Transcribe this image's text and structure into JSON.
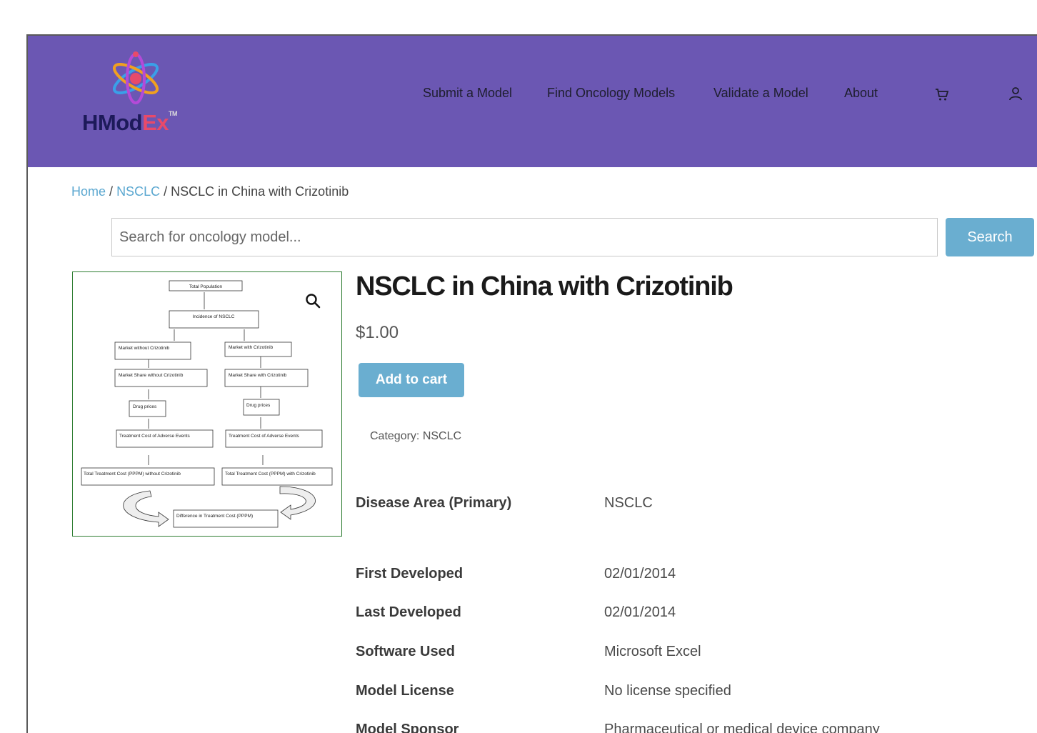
{
  "brand": {
    "name_part1": "HMod",
    "name_part2": "Ex",
    "trademark": "TM"
  },
  "nav": {
    "items": [
      {
        "label": "Submit a Model"
      },
      {
        "label": "Find Oncology Models"
      },
      {
        "label": "Validate a Model"
      },
      {
        "label": "About"
      }
    ],
    "cart_icon": "cart-icon",
    "account_icon": "user-icon"
  },
  "breadcrumb": {
    "home": "Home",
    "separator": "/",
    "category": "NSCLC",
    "current": "NSCLC in China with Crizotinib"
  },
  "search": {
    "placeholder": "Search for oncology model...",
    "value": "",
    "button_label": "Search"
  },
  "product": {
    "title": "NSCLC in China with Crizotinib",
    "price": "$1.00",
    "add_to_cart_label": "Add to cart",
    "category_label": "Category:",
    "category_value": "NSCLC",
    "image": {
      "top": "Total Population",
      "incidence": "Incidence of NSCLC",
      "left_market": "Market without Crizotinib",
      "right_market": "Market with Crizotinib",
      "left_share": "Market Share without Crizotinib",
      "right_share": "Market Share with Crizotinib",
      "drug_prices": "Drug prices",
      "adverse": "Treatment Cost of Adverse Events",
      "left_total": "Total Treatment Cost (PPPM) without Crizotinib",
      "right_total": "Total Treatment Cost (PPPM) with Crizotinib",
      "difference": "Difference in Treatment Cost (PPPM)"
    }
  },
  "specs": [
    {
      "label": "Disease Area (Primary)",
      "value": "NSCLC"
    },
    {
      "label": "First Developed",
      "value": "02/01/2014"
    },
    {
      "label": "Last Developed",
      "value": "02/01/2014"
    },
    {
      "label": "Software Used",
      "value": "Microsoft Excel"
    },
    {
      "label": "Model License",
      "value": "No license specified"
    },
    {
      "label": "Model Sponsor",
      "value": "Pharmaceutical or medical device company"
    }
  ],
  "colors": {
    "header": "#6b57b3",
    "accent": "#6aaed0",
    "link": "#5aa7d0"
  }
}
